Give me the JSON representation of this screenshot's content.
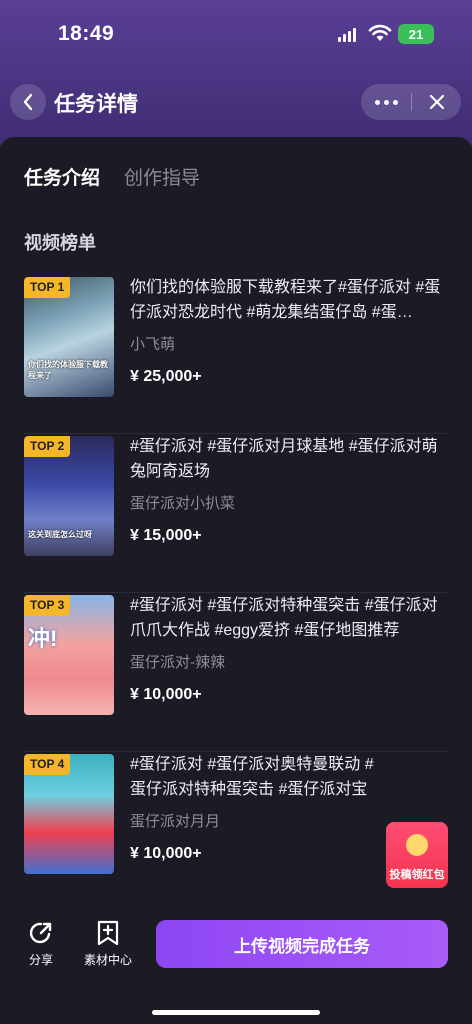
{
  "status": {
    "time": "18:49",
    "battery": "21"
  },
  "nav": {
    "title": "任务详情"
  },
  "tabs": [
    {
      "label": "任务介绍",
      "active": true
    },
    {
      "label": "创作指导",
      "active": false
    }
  ],
  "section_title": "视频榜单",
  "videos": [
    {
      "rank": "TOP 1",
      "title": "你们找的体验服下载教程来了#蛋仔派对 #蛋仔派对恐龙时代 #萌龙集结蛋仔岛 #蛋…",
      "author": "小飞萌",
      "reward": "¥ 25,000+",
      "caption": "你们找的体验服下载教程来了"
    },
    {
      "rank": "TOP 2",
      "title": "#蛋仔派对 #蛋仔派对月球基地 #蛋仔派对萌兔阿奇返场",
      "author": "蛋仔派对小扒菜",
      "reward": "¥ 15,000+",
      "caption": "这关到底怎么过呀"
    },
    {
      "rank": "TOP 3",
      "title": "#蛋仔派对 #蛋仔派对特种蛋突击 #蛋仔派对爪爪大作战 #eggy爱挤 #蛋仔地图推荐",
      "author": "蛋仔派对-辣辣",
      "reward": "¥ 10,000+",
      "caption": "冲!"
    },
    {
      "rank": "TOP 4",
      "title": "#蛋仔派对 #蛋仔派对奥特曼联动 #蛋仔派对特种蛋突击 #蛋仔派对宝藏地图推荐",
      "author": "蛋仔派对月月",
      "reward": "¥ 10,000+",
      "caption": ""
    }
  ],
  "floating": {
    "label": "投稿领红包"
  },
  "bottom": {
    "share": "分享",
    "material": "素材中心",
    "upload": "上传视频完成任务"
  },
  "colors": {
    "accent": "#9b51f5",
    "rank_badge": "#f5b62a",
    "red_packet": "#f5334f"
  }
}
